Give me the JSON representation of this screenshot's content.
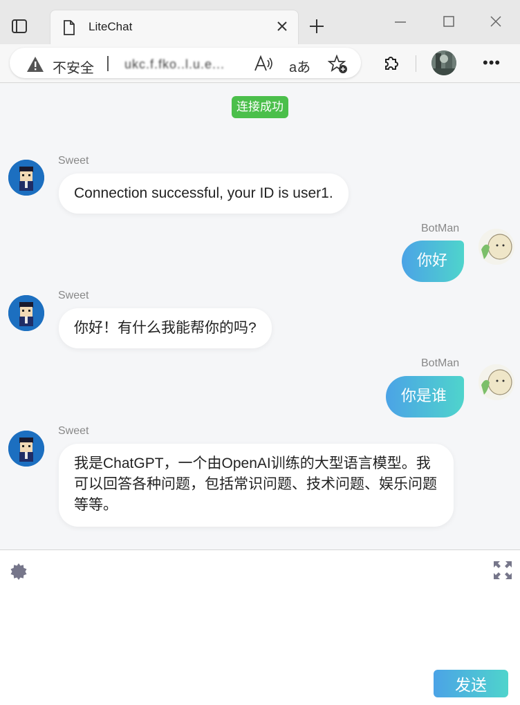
{
  "browser": {
    "tab_title": "LiteChat",
    "security_label": "不安全",
    "url": "ukc.f.fko..l.u.e...",
    "translate_glyph": "aあ",
    "menu_glyph": "•••"
  },
  "chat": {
    "status": "连接成功",
    "messages": [
      {
        "sender": "Sweet",
        "side": "left",
        "text": "Connection successful, your ID is user1."
      },
      {
        "sender": "BotMan",
        "side": "right",
        "text": "你好"
      },
      {
        "sender": "Sweet",
        "side": "left",
        "text": "你好！有什么我能帮你的吗?"
      },
      {
        "sender": "BotMan",
        "side": "right",
        "text": "你是谁"
      },
      {
        "sender": "Sweet",
        "side": "left",
        "text": "我是ChatGPT，一个由OpenAI训练的大型语言模型。我可以回答各种问题，包括常识问题、技术问题、娱乐问题等等。"
      }
    ]
  },
  "input": {
    "send_label": "发送"
  },
  "colors": {
    "accent_gradient_start": "#4ba3e6",
    "accent_gradient_end": "#4fd4cc",
    "status_green": "#4bbf4b"
  }
}
